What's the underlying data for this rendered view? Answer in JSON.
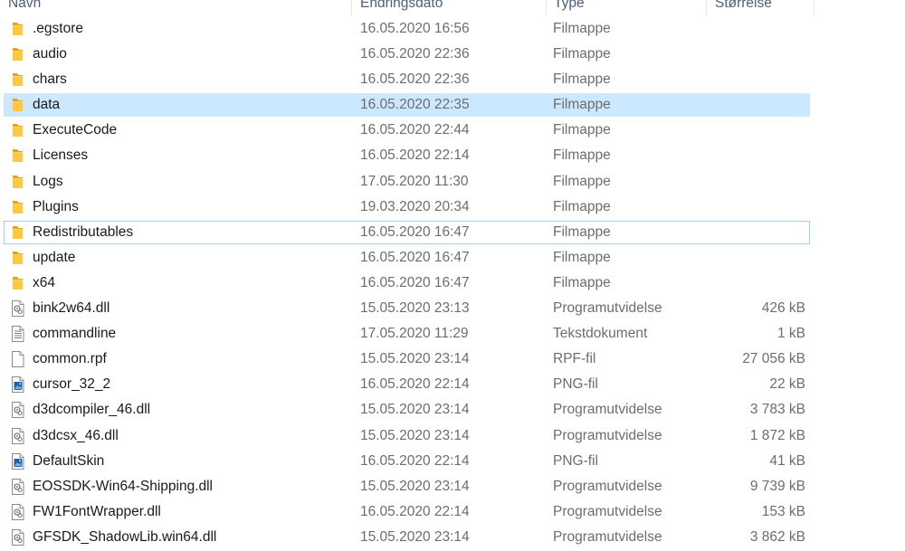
{
  "columns": {
    "name": "Navn",
    "date": "Endringsdato",
    "type": "Type",
    "size": "Størrelse"
  },
  "colors": {
    "folder": "#ffc83d",
    "selection": "#cce8ff",
    "focus_border": "#99d1ff",
    "header_text": "#4c607a"
  },
  "files": [
    {
      "name": ".egstore",
      "date": "16.05.2020 16:56",
      "type": "Filmappe",
      "size": "",
      "icon": "folder-icon"
    },
    {
      "name": "audio",
      "date": "16.05.2020 22:36",
      "type": "Filmappe",
      "size": "",
      "icon": "folder-icon"
    },
    {
      "name": "chars",
      "date": "16.05.2020 22:36",
      "type": "Filmappe",
      "size": "",
      "icon": "folder-icon"
    },
    {
      "name": "data",
      "date": "16.05.2020 22:35",
      "type": "Filmappe",
      "size": "",
      "icon": "folder-icon",
      "state": "selected"
    },
    {
      "name": "ExecuteCode",
      "date": "16.05.2020 22:44",
      "type": "Filmappe",
      "size": "",
      "icon": "folder-icon"
    },
    {
      "name": "Licenses",
      "date": "16.05.2020 22:14",
      "type": "Filmappe",
      "size": "",
      "icon": "folder-icon"
    },
    {
      "name": "Logs",
      "date": "17.05.2020 11:30",
      "type": "Filmappe",
      "size": "",
      "icon": "folder-icon"
    },
    {
      "name": "Plugins",
      "date": "19.03.2020 20:34",
      "type": "Filmappe",
      "size": "",
      "icon": "folder-icon"
    },
    {
      "name": "Redistributables",
      "date": "16.05.2020 16:47",
      "type": "Filmappe",
      "size": "",
      "icon": "folder-icon",
      "state": "focused"
    },
    {
      "name": "update",
      "date": "16.05.2020 16:47",
      "type": "Filmappe",
      "size": "",
      "icon": "folder-icon"
    },
    {
      "name": "x64",
      "date": "16.05.2020 16:47",
      "type": "Filmappe",
      "size": "",
      "icon": "folder-icon"
    },
    {
      "name": "bink2w64.dll",
      "date": "15.05.2020 23:13",
      "type": "Programutvidelse",
      "size": "426 kB",
      "icon": "dll-file-icon"
    },
    {
      "name": "commandline",
      "date": "17.05.2020 11:29",
      "type": "Tekstdokument",
      "size": "1 kB",
      "icon": "text-file-icon"
    },
    {
      "name": "common.rpf",
      "date": "15.05.2020 23:14",
      "type": "RPF-fil",
      "size": "27 056 kB",
      "icon": "blank-file-icon"
    },
    {
      "name": "cursor_32_2",
      "date": "16.05.2020 22:14",
      "type": "PNG-fil",
      "size": "22 kB",
      "icon": "image-file-icon"
    },
    {
      "name": "d3dcompiler_46.dll",
      "date": "15.05.2020 23:14",
      "type": "Programutvidelse",
      "size": "3 783 kB",
      "icon": "dll-file-icon"
    },
    {
      "name": "d3dcsx_46.dll",
      "date": "15.05.2020 23:14",
      "type": "Programutvidelse",
      "size": "1 872 kB",
      "icon": "dll-file-icon"
    },
    {
      "name": "DefaultSkin",
      "date": "16.05.2020 22:14",
      "type": "PNG-fil",
      "size": "41 kB",
      "icon": "image-file-icon"
    },
    {
      "name": "EOSSDK-Win64-Shipping.dll",
      "date": "15.05.2020 23:14",
      "type": "Programutvidelse",
      "size": "9 739 kB",
      "icon": "dll-file-icon"
    },
    {
      "name": "FW1FontWrapper.dll",
      "date": "16.05.2020 22:14",
      "type": "Programutvidelse",
      "size": "153 kB",
      "icon": "dll-file-icon"
    },
    {
      "name": "GFSDK_ShadowLib.win64.dll",
      "date": "15.05.2020 23:14",
      "type": "Programutvidelse",
      "size": "3 862 kB",
      "icon": "dll-file-icon"
    }
  ]
}
